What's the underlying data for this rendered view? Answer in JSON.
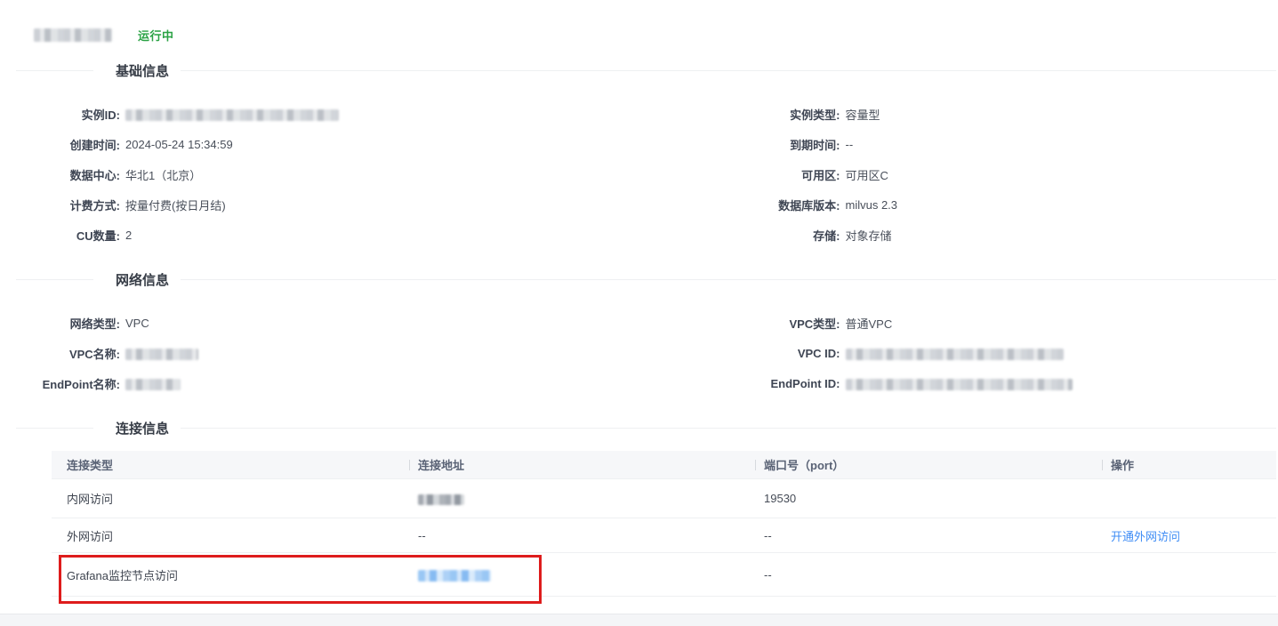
{
  "header": {
    "status": "运行中"
  },
  "sections": {
    "basic": {
      "title": "基础信息"
    },
    "network": {
      "title": "网络信息"
    },
    "connection": {
      "title": "连接信息"
    }
  },
  "basic": {
    "left": [
      {
        "label": "实例ID:",
        "value": "",
        "redacted": true
      },
      {
        "label": "创建时间:",
        "value": "2024-05-24 15:34:59"
      },
      {
        "label": "数据中心:",
        "value": "华北1（北京）"
      },
      {
        "label": "计费方式:",
        "value": "按量付费(按日月结)"
      },
      {
        "label": "CU数量:",
        "value": "2"
      }
    ],
    "right": [
      {
        "label": "实例类型:",
        "value": "容量型"
      },
      {
        "label": "到期时间:",
        "value": "--"
      },
      {
        "label": "可用区:",
        "value": "可用区C"
      },
      {
        "label": "数据库版本:",
        "value": "milvus 2.3"
      },
      {
        "label": "存储:",
        "value": "对象存储"
      }
    ]
  },
  "network": {
    "left": [
      {
        "label": "网络类型:",
        "value": "VPC"
      },
      {
        "label": "VPC名称:",
        "value": "",
        "redacted": true
      },
      {
        "label": "EndPoint名称:",
        "value": "",
        "redacted": true
      }
    ],
    "right": [
      {
        "label": "VPC类型:",
        "value": "普通VPC"
      },
      {
        "label": "VPC ID:",
        "value": "",
        "redacted": true
      },
      {
        "label": "EndPoint ID:",
        "value": "",
        "redacted": true
      }
    ]
  },
  "table": {
    "columns": [
      "连接类型",
      "连接地址",
      "端口号（port）",
      "操作"
    ],
    "rows": [
      {
        "type": "内网访问",
        "address": "",
        "address_redacted": true,
        "port": "19530",
        "action": ""
      },
      {
        "type": "外网访问",
        "address": "--",
        "port": "--",
        "action": "开通外网访问"
      },
      {
        "type": "Grafana监控节点访问",
        "address": "",
        "address_redacted": true,
        "port": "--",
        "action": ""
      }
    ]
  },
  "colors": {
    "status_green": "#2ba245",
    "link_blue": "#3e8cf5",
    "highlight_red": "#de1c1c"
  }
}
